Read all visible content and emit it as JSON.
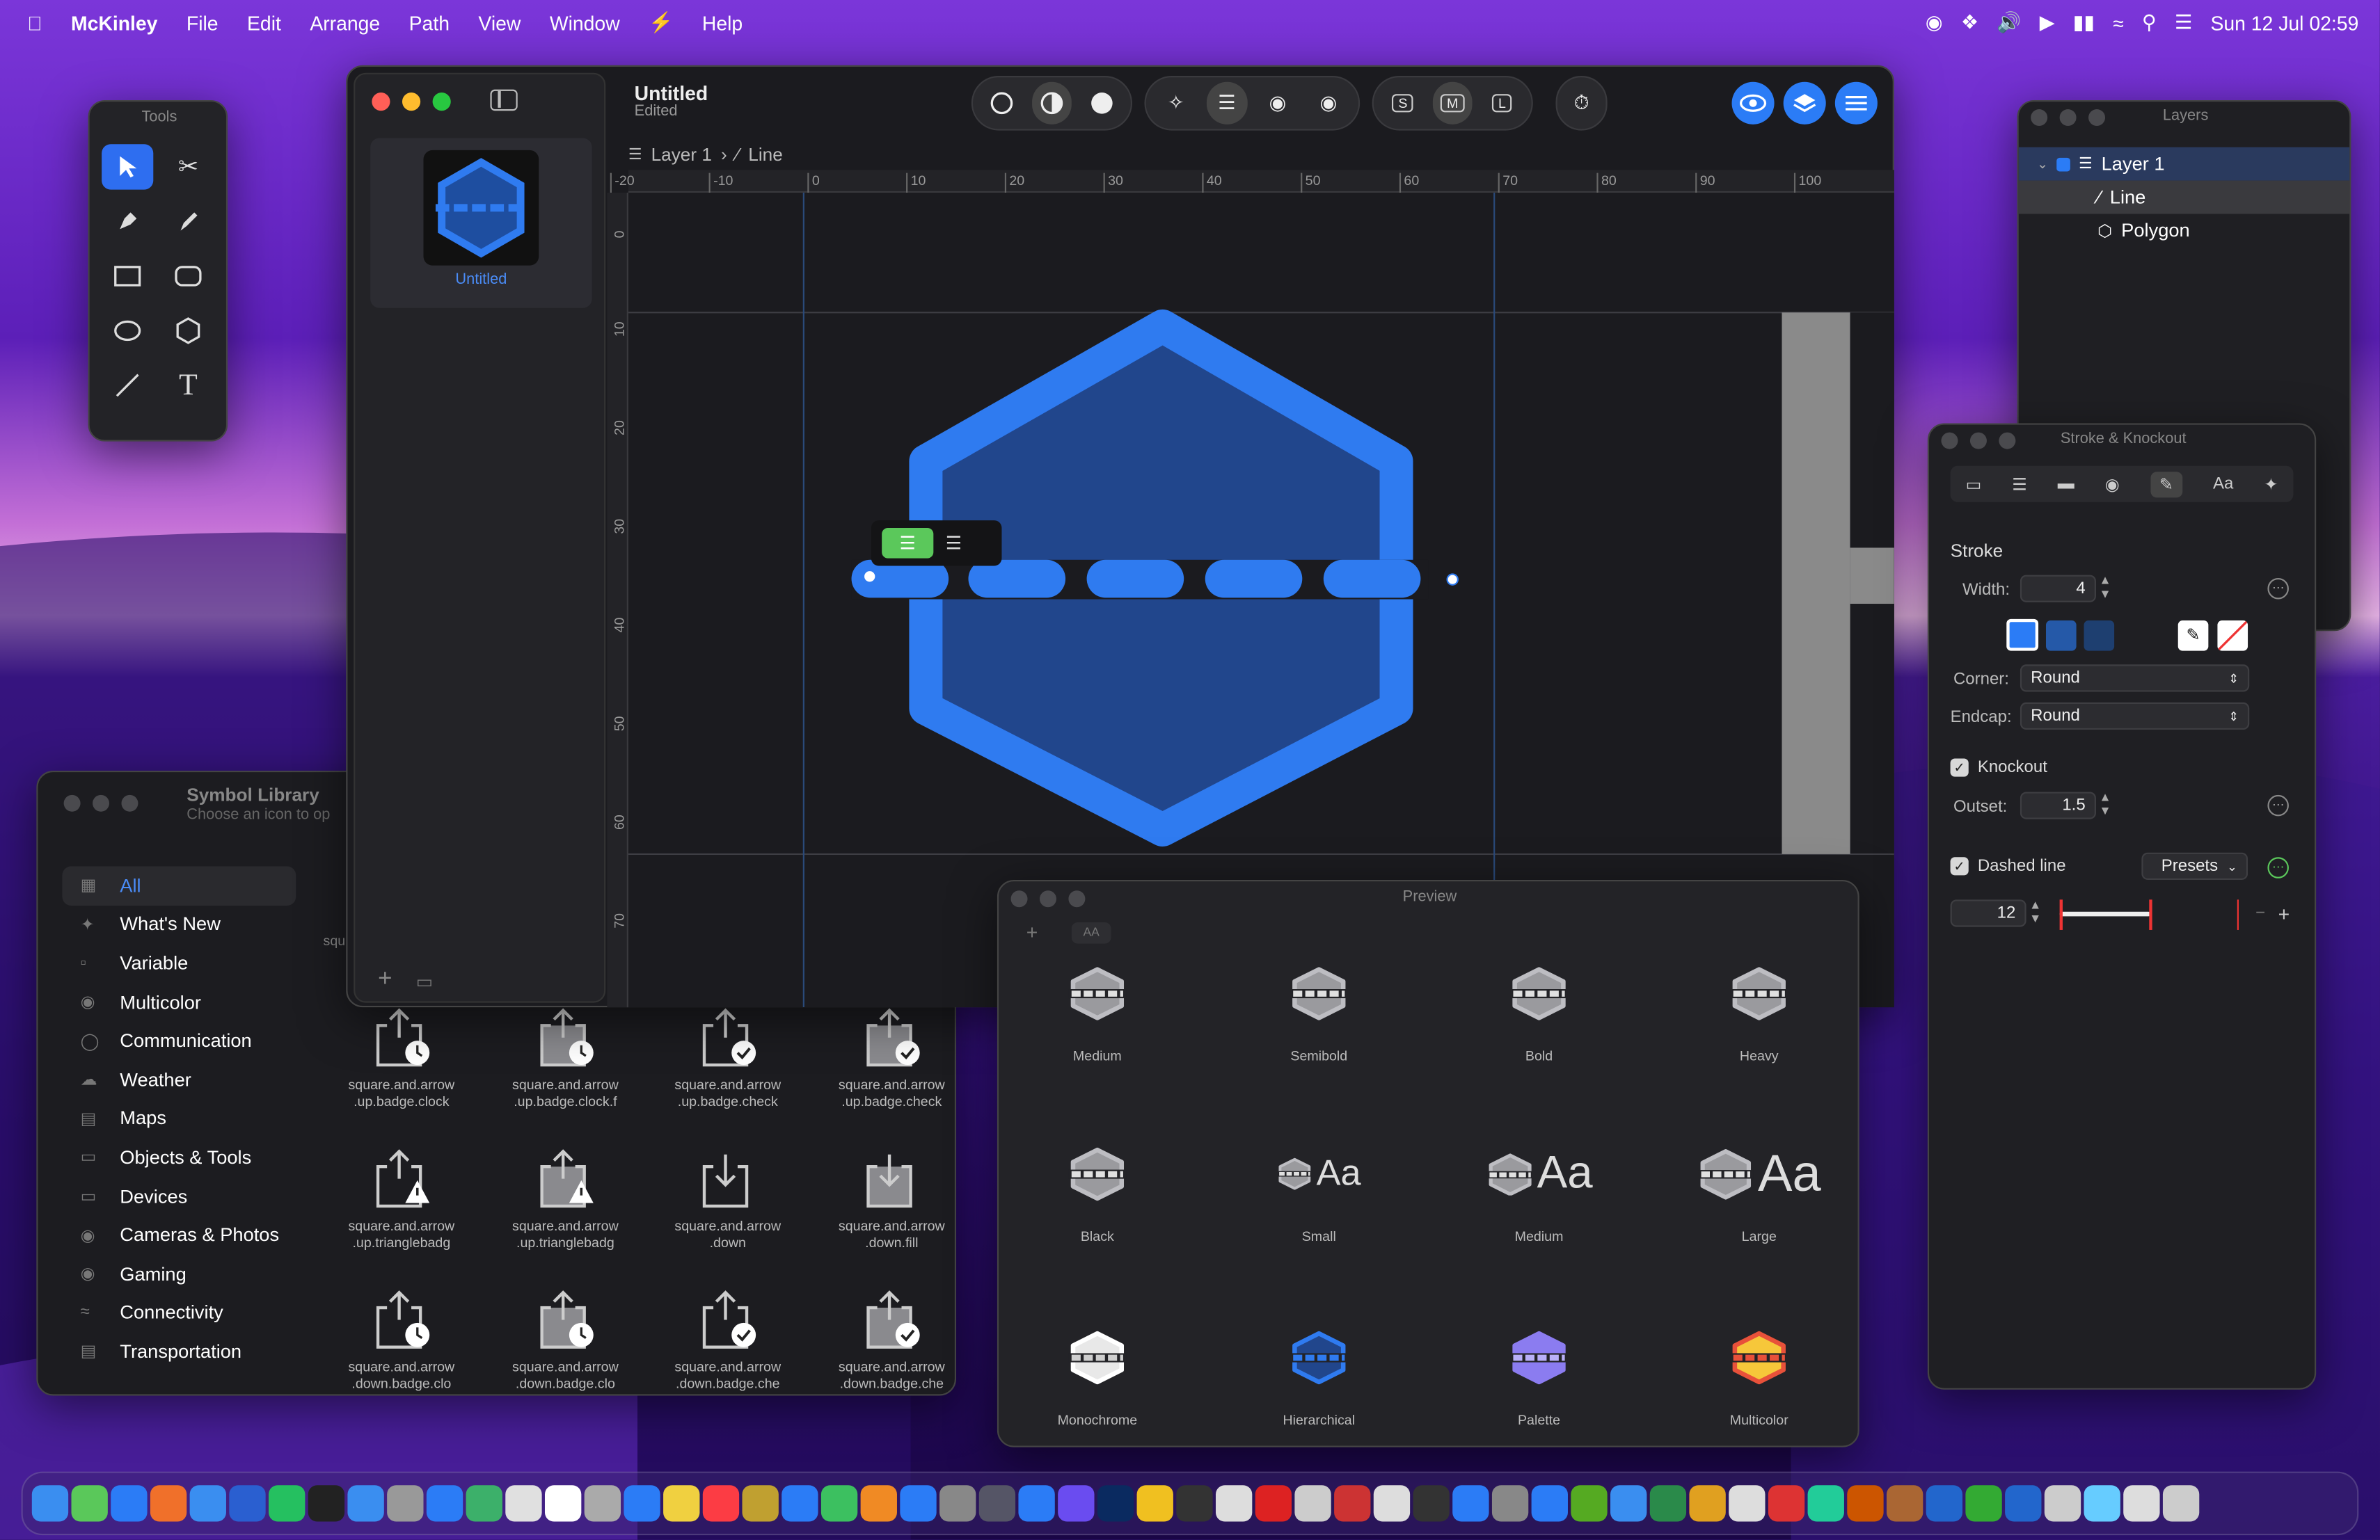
{
  "menubar": {
    "app_name": "McKinley",
    "items": [
      "File",
      "Edit",
      "Arrange",
      "Path",
      "View",
      "Window",
      "Help"
    ],
    "clock": "Sun 12 Jul  02:59"
  },
  "tools_panel": {
    "title": "Tools"
  },
  "document": {
    "sidebar_thumb_label": "Untitled",
    "title": "Untitled",
    "subtitle": "Edited",
    "breadcrumb": [
      "Layer 1",
      "Line"
    ],
    "ruler_h": [
      "-20",
      "-10",
      "0",
      "10",
      "20",
      "30",
      "40",
      "50",
      "60",
      "70",
      "80",
      "90",
      "100"
    ],
    "ruler_v": [
      "0",
      "10",
      "20",
      "30",
      "40",
      "50",
      "60",
      "70"
    ],
    "toolbar_size_labels": [
      "S",
      "M",
      "L"
    ]
  },
  "layers_panel": {
    "title": "Layers",
    "rows": [
      {
        "label": "Layer 1"
      },
      {
        "label": "Line"
      },
      {
        "label": "Polygon"
      }
    ]
  },
  "stroke_panel": {
    "title": "Stroke & Knockout",
    "tab_aa": "Aa",
    "section": "Stroke",
    "width_label": "Width:",
    "width_value": "4",
    "corner_label": "Corner:",
    "corner_value": "Round",
    "endcap_label": "Endcap:",
    "endcap_value": "Round",
    "knockout_label": "Knockout",
    "outset_label": "Outset:",
    "outset_value": "1.5",
    "dashed_label": "Dashed line",
    "presets_label": "Presets",
    "dash_value": "12",
    "swatches": [
      "#2b7cf6",
      "#2559a8",
      "#1e3f70"
    ]
  },
  "symbol_library": {
    "title": "Symbol Library",
    "subtitle": "Choose an icon to op",
    "partial_label": "squ",
    "categories": [
      "All",
      "What's New",
      "Variable",
      "Multicolor",
      "Communication",
      "Weather",
      "Maps",
      "Objects & Tools",
      "Devices",
      "Cameras & Photos",
      "Gaming",
      "Connectivity",
      "Transportation"
    ],
    "symbols": [
      {
        "name1": "square.and.arrow",
        "name2": ".up.badge.clock",
        "badge": "clock",
        "filled": false
      },
      {
        "name1": "square.and.arrow",
        "name2": ".up.badge.clock.f",
        "badge": "clock",
        "filled": true
      },
      {
        "name1": "square.and.arrow",
        "name2": ".up.badge.check",
        "badge": "check",
        "filled": false
      },
      {
        "name1": "square.and.arrow",
        "name2": ".up.badge.check",
        "badge": "check",
        "filled": true
      },
      {
        "name1": "square.and.arrow",
        "name2": ".up.trianglebadg",
        "badge": "warn",
        "filled": false
      },
      {
        "name1": "square.and.arrow",
        "name2": ".up.trianglebadg",
        "badge": "warn",
        "filled": true
      },
      {
        "name1": "square.and.arrow",
        "name2": ".down",
        "badge": "down",
        "filled": false
      },
      {
        "name1": "square.and.arrow",
        "name2": ".down.fill",
        "badge": "down",
        "filled": true
      },
      {
        "name1": "square.and.arrow",
        "name2": ".down.badge.clo",
        "badge": "clock",
        "filled": false
      },
      {
        "name1": "square.and.arrow",
        "name2": ".down.badge.clo",
        "badge": "clock",
        "filled": true
      },
      {
        "name1": "square.and.arrow",
        "name2": ".down.badge.che",
        "badge": "check",
        "filled": false
      },
      {
        "name1": "square.and.arrow",
        "name2": ".down.badge.che",
        "badge": "check",
        "filled": true
      }
    ]
  },
  "preview": {
    "title": "Preview",
    "aa_button": "AA",
    "cells": [
      {
        "label": "Medium",
        "kind": "weight"
      },
      {
        "label": "Semibold",
        "kind": "weight"
      },
      {
        "label": "Bold",
        "kind": "weight"
      },
      {
        "label": "Heavy",
        "kind": "weight"
      },
      {
        "label": "Black",
        "kind": "weight"
      },
      {
        "label": "Small",
        "kind": "aa",
        "aa": "Aa"
      },
      {
        "label": "Medium",
        "kind": "aa",
        "aa": "Aa"
      },
      {
        "label": "Large",
        "kind": "aa",
        "aa": "Aa"
      },
      {
        "label": "Monochrome",
        "kind": "mono"
      },
      {
        "label": "Hierarchical",
        "kind": "hier"
      },
      {
        "label": "Palette",
        "kind": "pal"
      },
      {
        "label": "Multicolor",
        "kind": "multi"
      }
    ]
  },
  "colors": {
    "accent": "#2b7cf6",
    "hexagon": "#2f7bf0",
    "knockout_green": "#5bc85b"
  }
}
